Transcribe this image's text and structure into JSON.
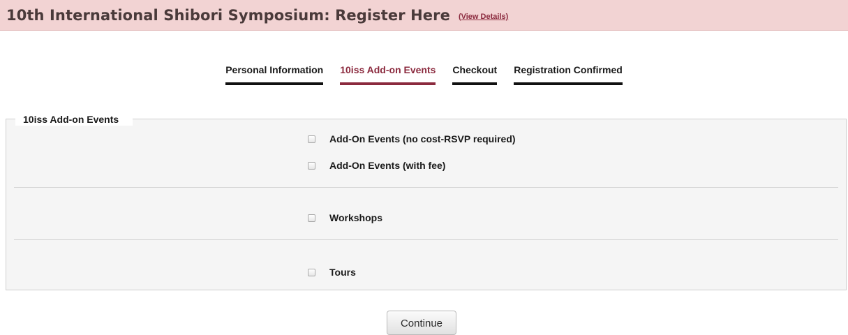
{
  "header": {
    "title": "10th International Shibori Symposium: Register Here",
    "details_link": "(View Details)"
  },
  "steps": [
    {
      "label": "Personal Information",
      "active": false
    },
    {
      "label": "10iss Add-on Events",
      "active": true
    },
    {
      "label": "Checkout",
      "active": false
    },
    {
      "label": "Registration Confirmed",
      "active": false
    }
  ],
  "section": {
    "legend": "10iss Add-on Events",
    "options": [
      {
        "label": "Add-On Events (no cost-RSVP required)",
        "checked": false
      },
      {
        "label": "Add-On Events (with fee)",
        "checked": false
      },
      {
        "label": "Workshops",
        "checked": false
      },
      {
        "label": "Tours",
        "checked": false
      }
    ]
  },
  "actions": {
    "continue_label": "Continue"
  },
  "colors": {
    "banner_bg": "#f2d3d3",
    "accent": "#8b2a3e",
    "panel_bg": "#f5f5f5"
  }
}
